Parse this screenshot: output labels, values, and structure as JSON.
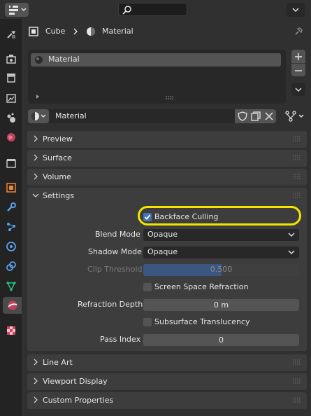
{
  "header": {
    "search_placeholder": ""
  },
  "breadcrumb": {
    "object": "Cube",
    "material": "Material"
  },
  "slots": {
    "items": [
      "Material"
    ]
  },
  "material_selector": {
    "name": "Material"
  },
  "panels": {
    "preview": "Preview",
    "surface": "Surface",
    "volume": "Volume",
    "settings": "Settings",
    "line_art": "Line Art",
    "viewport_display": "Viewport Display",
    "custom_properties": "Custom Properties"
  },
  "settings": {
    "backface_culling": {
      "label": "Backface Culling",
      "checked": true
    },
    "blend_mode": {
      "label": "Blend Mode",
      "value": "Opaque"
    },
    "shadow_mode": {
      "label": "Shadow Mode",
      "value": "Opaque"
    },
    "clip_threshold": {
      "label": "Clip Threshold",
      "value": "0.500",
      "fraction": 0.5
    },
    "screen_space_refraction": {
      "label": "Screen Space Refraction",
      "checked": false
    },
    "refraction_depth": {
      "label": "Refraction Depth",
      "value": "0 m"
    },
    "subsurface_translucency": {
      "label": "Subsurface Translucency",
      "checked": false
    },
    "pass_index": {
      "label": "Pass Index",
      "value": "0"
    }
  },
  "colors": {
    "highlight_ring": "#f2e600",
    "checkbox_checked": "#4772b3",
    "slider_fill": "#4772b3"
  }
}
